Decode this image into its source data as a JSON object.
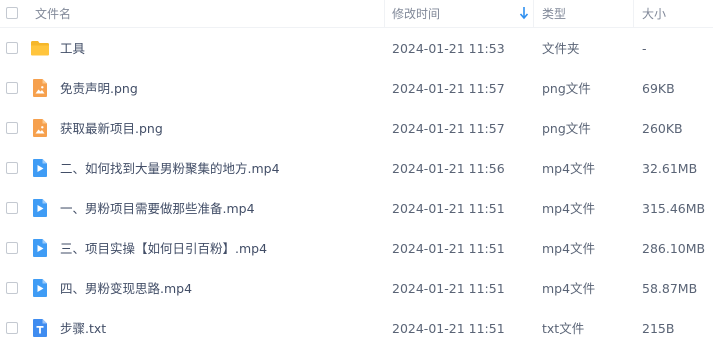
{
  "header": {
    "name": "文件名",
    "modified": "修改时间",
    "type": "类型",
    "size": "大小"
  },
  "files": [
    {
      "name": "工具",
      "modified": "2024-01-21 11:53",
      "type": "文件夹",
      "size": "-",
      "icon": "folder-icon"
    },
    {
      "name": "免责声明.png",
      "modified": "2024-01-21 11:57",
      "type": "png文件",
      "size": "69KB",
      "icon": "image-file-icon"
    },
    {
      "name": "获取最新项目.png",
      "modified": "2024-01-21 11:57",
      "type": "png文件",
      "size": "260KB",
      "icon": "image-file-icon"
    },
    {
      "name": "二、如何找到大量男粉聚集的地方.mp4",
      "modified": "2024-01-21 11:56",
      "type": "mp4文件",
      "size": "32.61MB",
      "icon": "video-file-icon"
    },
    {
      "name": "一、男粉项目需要做那些准备.mp4",
      "modified": "2024-01-21 11:51",
      "type": "mp4文件",
      "size": "315.46MB",
      "icon": "video-file-icon"
    },
    {
      "name": "三、项目实操【如何日引百粉】.mp4",
      "modified": "2024-01-21 11:51",
      "type": "mp4文件",
      "size": "286.10MB",
      "icon": "video-file-icon"
    },
    {
      "name": "四、男粉变现思路.mp4",
      "modified": "2024-01-21 11:51",
      "type": "mp4文件",
      "size": "58.87MB",
      "icon": "video-file-icon"
    },
    {
      "name": "步骤.txt",
      "modified": "2024-01-21 11:51",
      "type": "txt文件",
      "size": "215B",
      "icon": "text-file-icon"
    }
  ],
  "colors": {
    "folder": "#ffc53d",
    "image": "#f6a04d",
    "video": "#3f9cf5",
    "text": "#3f8cf0",
    "sort_arrow": "#2e8ff0"
  }
}
